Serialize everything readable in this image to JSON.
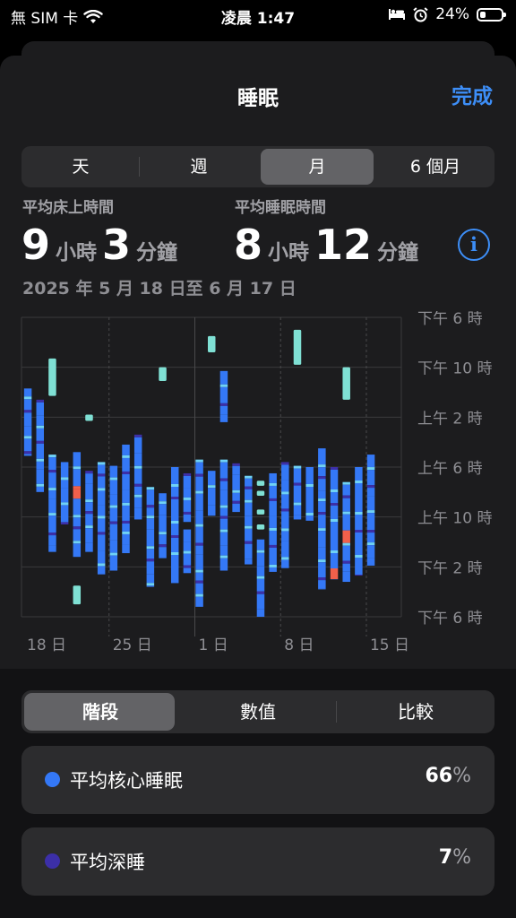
{
  "status": {
    "carrier": "無 SIM 卡",
    "time": "凌晨 1:47",
    "battery": "24%",
    "battery_level": 0.24
  },
  "header": {
    "title": "睡眠",
    "done": "完成"
  },
  "period_tabs": [
    "天",
    "週",
    "月",
    "6 個月"
  ],
  "selected_period": 2,
  "stats": {
    "in_bed_label": "平均床上時間",
    "in_bed_hours": "9",
    "in_bed_hours_unit": "小時",
    "in_bed_minutes": "3",
    "in_bed_minutes_unit": "分鐘",
    "asleep_label": "平均睡眠時間",
    "asleep_hours": "8",
    "asleep_hours_unit": "小時",
    "asleep_minutes": "12",
    "asleep_minutes_unit": "分鐘",
    "date_range": "2025 年 5 月 18 日至 6 月 17 日"
  },
  "chart_data": {
    "type": "bar",
    "x_tick_labels": [
      "18 日",
      "25 日",
      "1 日",
      "8 日",
      "15 日"
    ],
    "y_tick_labels": [
      "下午 6 時",
      "下午 10 時",
      "上午 2 時",
      "上午 6 時",
      "上午 10 時",
      "下午 2 時",
      "下午 6 時"
    ],
    "y_range_hours_from_6pm": [
      0,
      24
    ],
    "grid": true,
    "series_colors": {
      "awake": "#f0604b",
      "rem": "#6fd2f5",
      "core": "#3478f6",
      "deep": "#3c2fa8",
      "in_bed": "#7fe0d4"
    },
    "days": [
      {
        "day": 1,
        "in_bed": [],
        "sleep": [
          [
            5.7,
            11.1
          ]
        ]
      },
      {
        "day": 2,
        "in_bed": [],
        "sleep": [
          [
            6.6,
            14.0
          ]
        ]
      },
      {
        "day": 3,
        "in_bed": [
          [
            3.3,
            6.3
          ]
        ],
        "sleep": [
          [
            11.0,
            18.8
          ]
        ]
      },
      {
        "day": 4,
        "in_bed": [],
        "sleep": [
          [
            11.6,
            16.6
          ]
        ]
      },
      {
        "day": 5,
        "in_bed": [
          [
            21.5,
            23.0
          ]
        ],
        "sleep": [
          [
            10.8,
            19.2
          ]
        ]
      },
      {
        "day": 6,
        "in_bed": [
          [
            7.8,
            8.3
          ]
        ],
        "sleep": [
          [
            12.3,
            18.8
          ]
        ]
      },
      {
        "day": 7,
        "in_bed": [],
        "sleep": [
          [
            11.6,
            20.6
          ]
        ]
      },
      {
        "day": 8,
        "in_bed": [],
        "sleep": [
          [
            11.9,
            20.3
          ]
        ]
      },
      {
        "day": 9,
        "in_bed": [],
        "sleep": [
          [
            10.2,
            18.9
          ]
        ]
      },
      {
        "day": 10,
        "in_bed": [],
        "sleep": [
          [
            9.4,
            16.2
          ]
        ]
      },
      {
        "day": 11,
        "in_bed": [],
        "sleep": [
          [
            13.6,
            21.6
          ]
        ]
      },
      {
        "day": 12,
        "in_bed": [
          [
            4.0,
            5.1
          ]
        ],
        "sleep": [
          [
            14.1,
            19.3
          ]
        ]
      },
      {
        "day": 13,
        "in_bed": [],
        "sleep": [
          [
            12.0,
            21.3
          ]
        ]
      },
      {
        "day": 14,
        "in_bed": [],
        "sleep": [
          [
            12.5,
            16.4
          ],
          [
            17.0,
            20.5
          ]
        ]
      },
      {
        "day": 15,
        "in_bed": [],
        "sleep": [
          [
            11.4,
            23.2
          ]
        ]
      },
      {
        "day": 16,
        "in_bed": [
          [
            1.5,
            2.8
          ]
        ],
        "sleep": [
          [
            12.3,
            15.9
          ]
        ]
      },
      {
        "day": 17,
        "in_bed": [],
        "sleep": [
          [
            4.3,
            8.4
          ],
          [
            11.4,
            20.3
          ]
        ]
      },
      {
        "day": 18,
        "in_bed": [],
        "sleep": [
          [
            11.7,
            15.6
          ]
        ]
      },
      {
        "day": 19,
        "in_bed": [],
        "sleep": [
          [
            12.7,
            19.8
          ]
        ]
      },
      {
        "day": 20,
        "in_bed": [
          [
            13.1,
            13.5
          ],
          [
            13.9,
            14.3
          ],
          [
            15.4,
            15.8
          ],
          [
            16.6,
            17.0
          ]
        ],
        "sleep": [
          [
            17.8,
            24.0
          ]
        ]
      },
      {
        "day": 21,
        "in_bed": [],
        "sleep": [
          [
            12.5,
            20.4
          ]
        ]
      },
      {
        "day": 22,
        "in_bed": [],
        "sleep": [
          [
            11.6,
            20.1
          ]
        ]
      },
      {
        "day": 23,
        "in_bed": [
          [
            1.0,
            3.8
          ]
        ],
        "sleep": [
          [
            11.9,
            16.2
          ]
        ]
      },
      {
        "day": 24,
        "in_bed": [],
        "sleep": [
          [
            12.0,
            16.3
          ]
        ]
      },
      {
        "day": 25,
        "in_bed": [],
        "sleep": [
          [
            10.5,
            21.8
          ]
        ]
      },
      {
        "day": 26,
        "in_bed": [],
        "sleep": [
          [
            12.0,
            21.0
          ]
        ]
      },
      {
        "day": 27,
        "in_bed": [
          [
            4.0,
            6.6
          ]
        ],
        "sleep": [
          [
            13.2,
            21.2
          ]
        ]
      },
      {
        "day": 28,
        "in_bed": [],
        "sleep": [
          [
            12.0,
            20.7
          ]
        ]
      },
      {
        "day": 29,
        "in_bed": [],
        "sleep": [
          [
            11.0,
            19.9
          ]
        ]
      }
    ]
  },
  "view_tabs": [
    "階段",
    "數值",
    "比較"
  ],
  "selected_view": 0,
  "cards": [
    {
      "label": "平均核心睡眠",
      "value": "66",
      "unit": "%",
      "color": "#3478f6"
    },
    {
      "label": "平均深睡",
      "value": "7",
      "unit": "%",
      "color": "#3c2fa8"
    }
  ]
}
